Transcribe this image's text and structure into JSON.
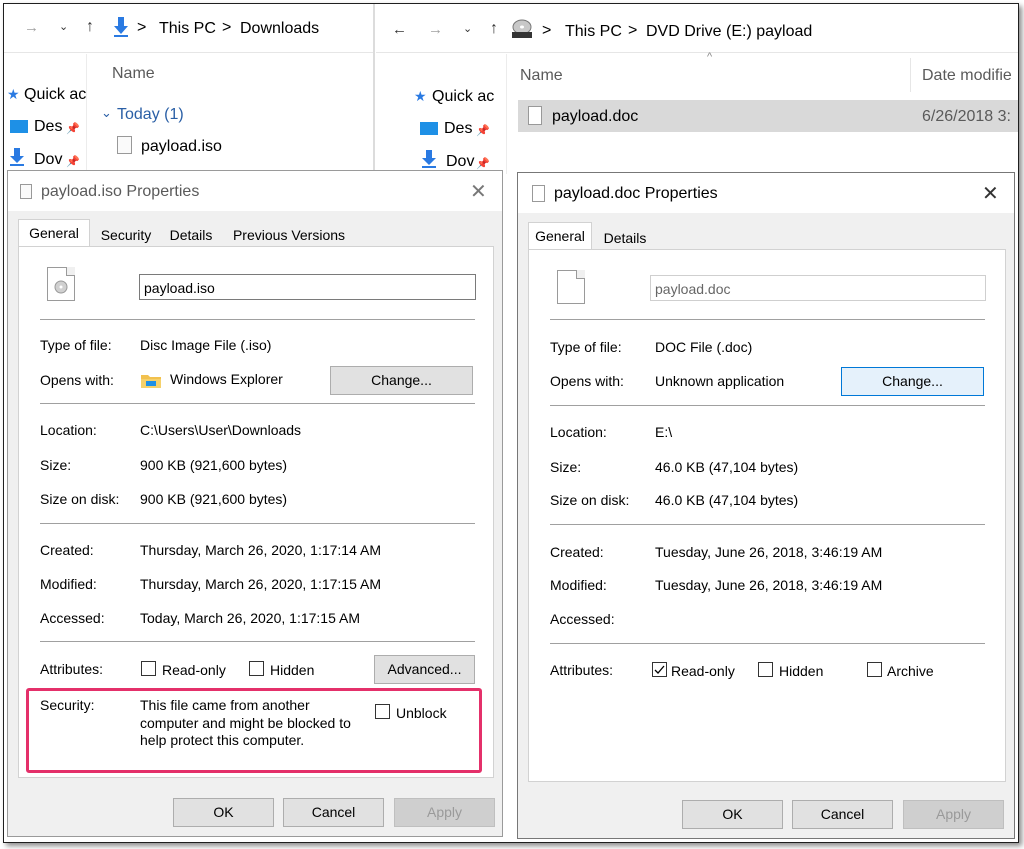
{
  "left_explorer": {
    "breadcrumb": [
      "This PC",
      "Downloads"
    ],
    "sep": ">",
    "column_header": "Name",
    "group": "Today (1)",
    "file": "payload.iso",
    "nav": [
      "Quick ac",
      "Des",
      "Dov"
    ]
  },
  "right_explorer": {
    "breadcrumb": [
      "This PC",
      "DVD Drive (E:) payload"
    ],
    "sep": ">",
    "col_name": "Name",
    "col_date": "Date modifie",
    "file": "payload.doc",
    "file_date": "6/26/2018 3:",
    "nav": [
      "Quick ac",
      "Des",
      "Dov"
    ]
  },
  "iso_dialog": {
    "title": "payload.iso Properties",
    "tabs": [
      "General",
      "Security",
      "Details",
      "Previous Versions"
    ],
    "filename": "payload.iso",
    "type_label": "Type of file:",
    "type_value": "Disc Image File (.iso)",
    "opens_label": "Opens with:",
    "opens_value": "Windows Explorer",
    "change": "Change...",
    "location_label": "Location:",
    "location_value": "C:\\Users\\User\\Downloads",
    "size_label": "Size:",
    "size_value": "900 KB (921,600 bytes)",
    "disk_label": "Size on disk:",
    "disk_value": "900 KB (921,600 bytes)",
    "created_label": "Created:",
    "created_value": "Thursday, March 26, 2020, 1:17:14 AM",
    "modified_label": "Modified:",
    "modified_value": "Thursday, March 26, 2020, 1:17:15 AM",
    "accessed_label": "Accessed:",
    "accessed_value": "Today, March 26, 2020, 1:17:15 AM",
    "attr_label": "Attributes:",
    "readonly": "Read-only",
    "hidden": "Hidden",
    "advanced": "Advanced...",
    "security_label": "Security:",
    "security_lines": [
      "This file came from another",
      "computer and might be blocked to",
      "help protect this computer."
    ],
    "unblock": "Unblock",
    "ok": "OK",
    "cancel": "Cancel",
    "apply": "Apply"
  },
  "doc_dialog": {
    "title": "payload.doc Properties",
    "tabs": [
      "General",
      "Details"
    ],
    "filename": "payload.doc",
    "type_label": "Type of file:",
    "type_value": "DOC File (.doc)",
    "opens_label": "Opens with:",
    "opens_value": "Unknown application",
    "change": "Change...",
    "location_label": "Location:",
    "location_value": "E:\\",
    "size_label": "Size:",
    "size_value": "46.0 KB (47,104 bytes)",
    "disk_label": "Size on disk:",
    "disk_value": "46.0 KB (47,104 bytes)",
    "created_label": "Created:",
    "created_value": "Tuesday, June 26, 2018, 3:46:19 AM",
    "modified_label": "Modified:",
    "modified_value": "Tuesday, June 26, 2018, 3:46:19 AM",
    "accessed_label": "Accessed:",
    "attr_label": "Attributes:",
    "readonly": "Read-only",
    "hidden": "Hidden",
    "archive": "Archive",
    "ok": "OK",
    "cancel": "Cancel",
    "apply": "Apply"
  },
  "colors": {
    "accent": "#0078d7",
    "highlight": "#e4306a",
    "folder_blue": "#2a5fa6"
  }
}
